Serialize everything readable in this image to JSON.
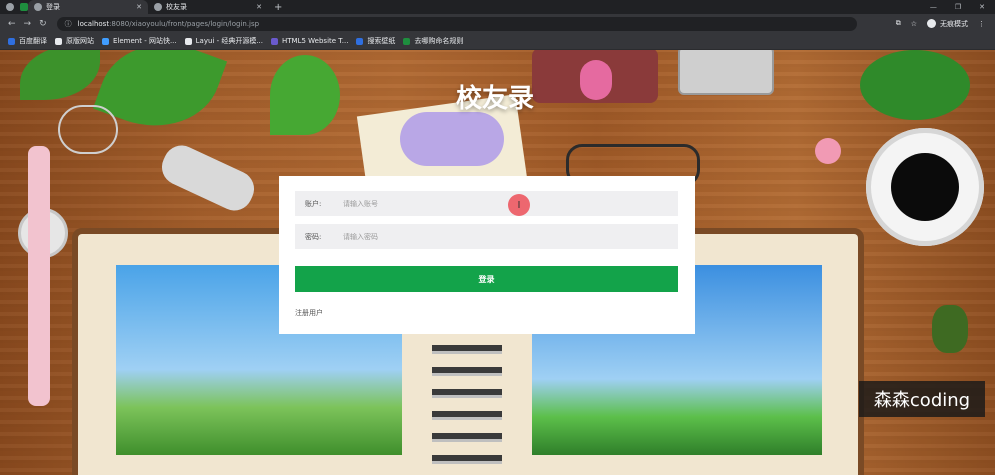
{
  "browser": {
    "tabs": [
      {
        "label": "登录",
        "active": true
      },
      {
        "label": "校友录",
        "active": false
      }
    ],
    "url": {
      "host": "localhost",
      "path": ":8080/xiaoyoulu/front/pages/login/login.jsp"
    },
    "incognito_label": "无痕模式",
    "bookmarks": [
      {
        "label": "百度翻译",
        "color": "#2f6fe0"
      },
      {
        "label": "原版网站",
        "color": "#e8eaed"
      },
      {
        "label": "Element - 网站快...",
        "color": "#409eff"
      },
      {
        "label": "Layui - 经典开源模...",
        "color": "#e8eaed"
      },
      {
        "label": "HTML5 Website T...",
        "color": "#6a5acd"
      },
      {
        "label": "搜索壁纸",
        "color": "#2f6fe0"
      },
      {
        "label": "去哪购命名规则",
        "color": "#1e8e3e"
      }
    ]
  },
  "page": {
    "title": "校友录",
    "account_label": "账户:",
    "account_placeholder": "请输入账号",
    "password_label": "密码:",
    "password_placeholder": "请输入密码",
    "login_button": "登录",
    "register_link": "注册用户",
    "cursor_glyph": "I"
  },
  "watermark": "森森coding",
  "colors": {
    "login_button": "#13a34a",
    "cursor": "#ec5860"
  }
}
